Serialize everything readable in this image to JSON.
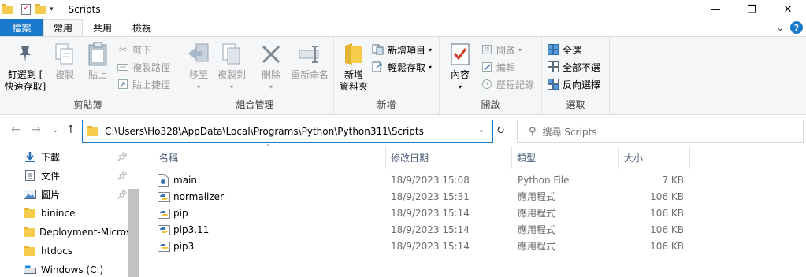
{
  "window": {
    "title": "Scripts"
  },
  "ribbon_tabs": {
    "file": "檔案",
    "home": "常用",
    "share": "共用",
    "view": "檢視"
  },
  "ribbon": {
    "clipboard": {
      "label": "剪貼簿",
      "pin_line1": "釘選到 [",
      "pin_line2": "快速存取]",
      "copy": "複製",
      "paste": "貼上",
      "cut": "剪下",
      "copy_path": "複製路徑",
      "paste_shortcut": "貼上捷徑"
    },
    "organize": {
      "label": "組合管理",
      "move_to": "移至",
      "copy_to": "複製到",
      "delete": "刪除",
      "rename": "重新命名"
    },
    "new": {
      "label": "新增",
      "new_folder_line1": "新增",
      "new_folder_line2": "資料夾",
      "new_item": "新增項目",
      "easy_access": "輕鬆存取"
    },
    "open": {
      "label": "開啟",
      "properties": "內容",
      "open": "開啟",
      "edit": "編輯",
      "history": "歷程記錄"
    },
    "select": {
      "label": "選取",
      "select_all": "全選",
      "select_none": "全部不選",
      "invert": "反向選擇"
    }
  },
  "address": {
    "path": "C:\\Users\\Ho328\\AppData\\Local\\Programs\\Python\\Python311\\Scripts",
    "search_placeholder": "搜尋 Scripts"
  },
  "nav_pane": {
    "items": [
      {
        "label": "下載",
        "icon": "download-icon",
        "pinned": true
      },
      {
        "label": "文件",
        "icon": "document-icon",
        "pinned": true
      },
      {
        "label": "圖片",
        "icon": "picture-icon",
        "pinned": true
      },
      {
        "label": "binince",
        "icon": "folder-icon",
        "pinned": false
      },
      {
        "label": "Deployment-Micros",
        "icon": "folder-icon",
        "pinned": false
      },
      {
        "label": "htdocs",
        "icon": "folder-icon",
        "pinned": false
      },
      {
        "label": "Windows (C:)",
        "icon": "drive-icon",
        "pinned": false
      }
    ]
  },
  "columns": {
    "name": "名稱",
    "date": "修改日期",
    "type": "類型",
    "size": "大小"
  },
  "files": [
    {
      "name": "main",
      "date": "18/9/2023 15:08",
      "type": "Python File",
      "size": "7 KB",
      "icon": "python-file-icon"
    },
    {
      "name": "normalizer",
      "date": "18/9/2023 15:31",
      "type": "應用程式",
      "size": "106 KB",
      "icon": "python-exe-icon"
    },
    {
      "name": "pip",
      "date": "18/9/2023 15:14",
      "type": "應用程式",
      "size": "106 KB",
      "icon": "python-exe-icon"
    },
    {
      "name": "pip3.11",
      "date": "18/9/2023 15:14",
      "type": "應用程式",
      "size": "106 KB",
      "icon": "python-exe-icon"
    },
    {
      "name": "pip3",
      "date": "18/9/2023 15:14",
      "type": "應用程式",
      "size": "106 KB",
      "icon": "python-exe-icon"
    }
  ],
  "colors": {
    "accent": "#1979ca",
    "ribbon_bg": "#f5f6f7",
    "folder": "#f6cd4b"
  }
}
